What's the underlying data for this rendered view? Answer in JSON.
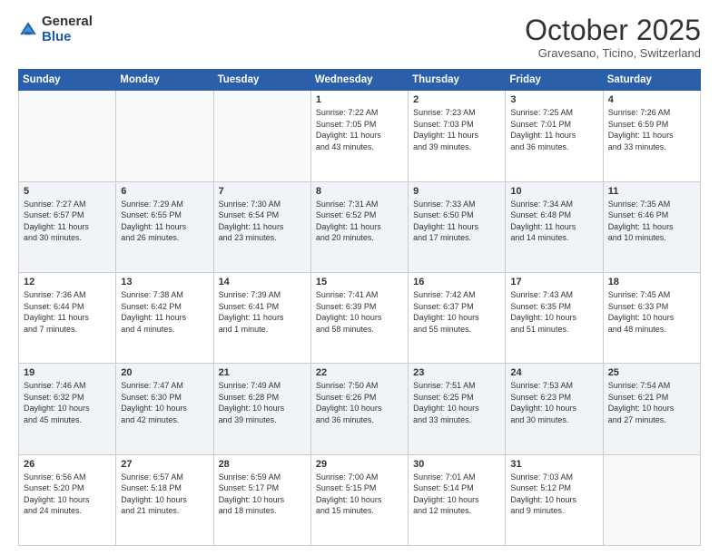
{
  "logo": {
    "general": "General",
    "blue": "Blue"
  },
  "header": {
    "month": "October 2025",
    "location": "Gravesano, Ticino, Switzerland"
  },
  "days": [
    "Sunday",
    "Monday",
    "Tuesday",
    "Wednesday",
    "Thursday",
    "Friday",
    "Saturday"
  ],
  "weeks": [
    [
      {
        "day": null,
        "info": null
      },
      {
        "day": null,
        "info": null
      },
      {
        "day": null,
        "info": null
      },
      {
        "day": "1",
        "info": "Sunrise: 7:22 AM\nSunset: 7:05 PM\nDaylight: 11 hours\nand 43 minutes."
      },
      {
        "day": "2",
        "info": "Sunrise: 7:23 AM\nSunset: 7:03 PM\nDaylight: 11 hours\nand 39 minutes."
      },
      {
        "day": "3",
        "info": "Sunrise: 7:25 AM\nSunset: 7:01 PM\nDaylight: 11 hours\nand 36 minutes."
      },
      {
        "day": "4",
        "info": "Sunrise: 7:26 AM\nSunset: 6:59 PM\nDaylight: 11 hours\nand 33 minutes."
      }
    ],
    [
      {
        "day": "5",
        "info": "Sunrise: 7:27 AM\nSunset: 6:57 PM\nDaylight: 11 hours\nand 30 minutes."
      },
      {
        "day": "6",
        "info": "Sunrise: 7:29 AM\nSunset: 6:55 PM\nDaylight: 11 hours\nand 26 minutes."
      },
      {
        "day": "7",
        "info": "Sunrise: 7:30 AM\nSunset: 6:54 PM\nDaylight: 11 hours\nand 23 minutes."
      },
      {
        "day": "8",
        "info": "Sunrise: 7:31 AM\nSunset: 6:52 PM\nDaylight: 11 hours\nand 20 minutes."
      },
      {
        "day": "9",
        "info": "Sunrise: 7:33 AM\nSunset: 6:50 PM\nDaylight: 11 hours\nand 17 minutes."
      },
      {
        "day": "10",
        "info": "Sunrise: 7:34 AM\nSunset: 6:48 PM\nDaylight: 11 hours\nand 14 minutes."
      },
      {
        "day": "11",
        "info": "Sunrise: 7:35 AM\nSunset: 6:46 PM\nDaylight: 11 hours\nand 10 minutes."
      }
    ],
    [
      {
        "day": "12",
        "info": "Sunrise: 7:36 AM\nSunset: 6:44 PM\nDaylight: 11 hours\nand 7 minutes."
      },
      {
        "day": "13",
        "info": "Sunrise: 7:38 AM\nSunset: 6:42 PM\nDaylight: 11 hours\nand 4 minutes."
      },
      {
        "day": "14",
        "info": "Sunrise: 7:39 AM\nSunset: 6:41 PM\nDaylight: 11 hours\nand 1 minute."
      },
      {
        "day": "15",
        "info": "Sunrise: 7:41 AM\nSunset: 6:39 PM\nDaylight: 10 hours\nand 58 minutes."
      },
      {
        "day": "16",
        "info": "Sunrise: 7:42 AM\nSunset: 6:37 PM\nDaylight: 10 hours\nand 55 minutes."
      },
      {
        "day": "17",
        "info": "Sunrise: 7:43 AM\nSunset: 6:35 PM\nDaylight: 10 hours\nand 51 minutes."
      },
      {
        "day": "18",
        "info": "Sunrise: 7:45 AM\nSunset: 6:33 PM\nDaylight: 10 hours\nand 48 minutes."
      }
    ],
    [
      {
        "day": "19",
        "info": "Sunrise: 7:46 AM\nSunset: 6:32 PM\nDaylight: 10 hours\nand 45 minutes."
      },
      {
        "day": "20",
        "info": "Sunrise: 7:47 AM\nSunset: 6:30 PM\nDaylight: 10 hours\nand 42 minutes."
      },
      {
        "day": "21",
        "info": "Sunrise: 7:49 AM\nSunset: 6:28 PM\nDaylight: 10 hours\nand 39 minutes."
      },
      {
        "day": "22",
        "info": "Sunrise: 7:50 AM\nSunset: 6:26 PM\nDaylight: 10 hours\nand 36 minutes."
      },
      {
        "day": "23",
        "info": "Sunrise: 7:51 AM\nSunset: 6:25 PM\nDaylight: 10 hours\nand 33 minutes."
      },
      {
        "day": "24",
        "info": "Sunrise: 7:53 AM\nSunset: 6:23 PM\nDaylight: 10 hours\nand 30 minutes."
      },
      {
        "day": "25",
        "info": "Sunrise: 7:54 AM\nSunset: 6:21 PM\nDaylight: 10 hours\nand 27 minutes."
      }
    ],
    [
      {
        "day": "26",
        "info": "Sunrise: 6:56 AM\nSunset: 5:20 PM\nDaylight: 10 hours\nand 24 minutes."
      },
      {
        "day": "27",
        "info": "Sunrise: 6:57 AM\nSunset: 5:18 PM\nDaylight: 10 hours\nand 21 minutes."
      },
      {
        "day": "28",
        "info": "Sunrise: 6:59 AM\nSunset: 5:17 PM\nDaylight: 10 hours\nand 18 minutes."
      },
      {
        "day": "29",
        "info": "Sunrise: 7:00 AM\nSunset: 5:15 PM\nDaylight: 10 hours\nand 15 minutes."
      },
      {
        "day": "30",
        "info": "Sunrise: 7:01 AM\nSunset: 5:14 PM\nDaylight: 10 hours\nand 12 minutes."
      },
      {
        "day": "31",
        "info": "Sunrise: 7:03 AM\nSunset: 5:12 PM\nDaylight: 10 hours\nand 9 minutes."
      },
      {
        "day": null,
        "info": null
      }
    ]
  ]
}
